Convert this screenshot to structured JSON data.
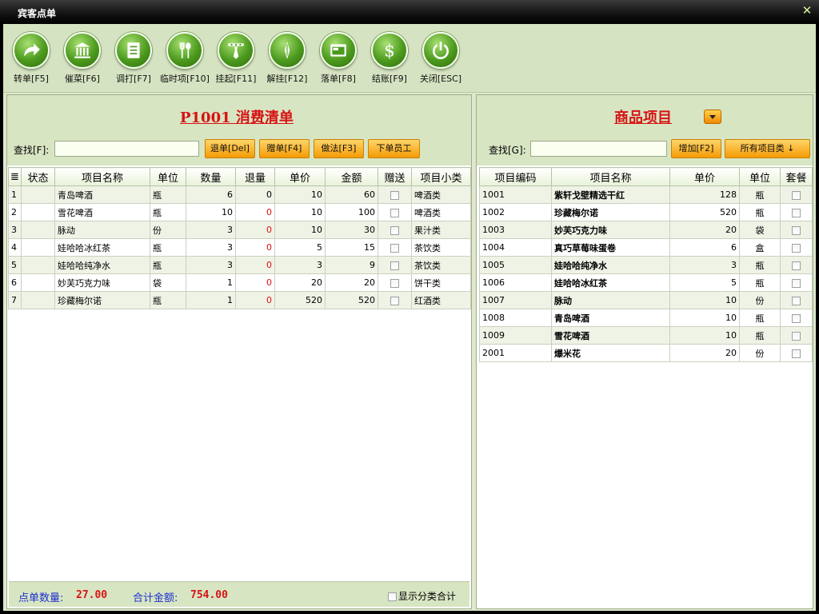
{
  "window": {
    "title": "宾客点单",
    "close_glyph": "✕"
  },
  "toolbar": [
    {
      "label": "转单[F5]",
      "icon": "share-arrow-icon"
    },
    {
      "label": "催菜[F6]",
      "icon": "bank-icon"
    },
    {
      "label": "调打[F7]",
      "icon": "document-icon"
    },
    {
      "label": "临时项[F10]",
      "icon": "fork-spoon-icon"
    },
    {
      "label": "挂起[F11]",
      "icon": "tie-icon"
    },
    {
      "label": "解挂[F12]",
      "icon": "pen-icon"
    },
    {
      "label": "落单[F8]",
      "icon": "window-icon"
    },
    {
      "label": "结账[F9]",
      "icon": "dollar-icon"
    },
    {
      "label": "关闭[ESC]",
      "icon": "power-icon"
    }
  ],
  "left": {
    "title": "P1001  消费清单",
    "search_label": "查找[F]:",
    "search_value": "",
    "buttons": [
      "退单[Del]",
      "赠单[F4]",
      "做法[F3]",
      "下单员工"
    ],
    "columns": [
      "≣",
      "状态",
      "项目名称",
      "单位",
      "数量",
      "退量",
      "单价",
      "金额",
      "赠送",
      "项目小类"
    ],
    "rows": [
      [
        "1",
        "",
        "青岛啤酒",
        "瓶",
        "6",
        "0",
        "10",
        "60",
        "",
        "啤酒类"
      ],
      [
        "2",
        "",
        "雪花啤酒",
        "瓶",
        "10",
        "0",
        "10",
        "100",
        "",
        "啤酒类"
      ],
      [
        "3",
        "",
        "脉动",
        "份",
        "3",
        "0",
        "10",
        "30",
        "",
        "果汁类"
      ],
      [
        "4",
        "",
        "娃哈哈冰红茶",
        "瓶",
        "3",
        "0",
        "5",
        "15",
        "",
        "茶饮类"
      ],
      [
        "5",
        "",
        "娃哈哈纯净水",
        "瓶",
        "3",
        "0",
        "3",
        "9",
        "",
        "茶饮类"
      ],
      [
        "6",
        "",
        "妙芙巧克力味",
        "袋",
        "1",
        "0",
        "20",
        "20",
        "",
        "饼干类"
      ],
      [
        "7",
        "",
        "珍藏梅尔诺",
        "瓶",
        "1",
        "0",
        "520",
        "520",
        "",
        "红酒类"
      ]
    ],
    "footer": {
      "count_label": "点单数量:",
      "count_value": "27.00",
      "total_label": "合计金额:",
      "total_value": "754.00",
      "show_category": "显示分类合计"
    }
  },
  "right": {
    "title": "商品项目",
    "search_label": "查找[G]:",
    "search_value": "",
    "add_button": "增加[F2]",
    "category_button": "所有项目类 ↓",
    "columns": [
      "项目编码",
      "项目名称",
      "单价",
      "单位",
      "套餐"
    ],
    "rows": [
      [
        "1001",
        "紫轩戈壁精选干红",
        "128",
        "瓶",
        ""
      ],
      [
        "1002",
        "珍藏梅尔诺",
        "520",
        "瓶",
        ""
      ],
      [
        "1003",
        "妙芙巧克力味",
        "20",
        "袋",
        ""
      ],
      [
        "1004",
        "真巧草莓味蛋卷",
        "6",
        "盒",
        ""
      ],
      [
        "1005",
        "娃哈哈纯净水",
        "3",
        "瓶",
        ""
      ],
      [
        "1006",
        "娃哈哈冰红茶",
        "5",
        "瓶",
        ""
      ],
      [
        "1007",
        "脉动",
        "10",
        "份",
        ""
      ],
      [
        "1008",
        "青岛啤酒",
        "10",
        "瓶",
        ""
      ],
      [
        "1009",
        "雪花啤酒",
        "10",
        "瓶",
        ""
      ],
      [
        "2001",
        "爆米花",
        "20",
        "份",
        ""
      ]
    ]
  },
  "colors": {
    "accent_red": "#d61414",
    "accent_blue": "#1a2fd0",
    "toolbar_green": "#4c9a1e",
    "button_orange": "#f49b05"
  }
}
